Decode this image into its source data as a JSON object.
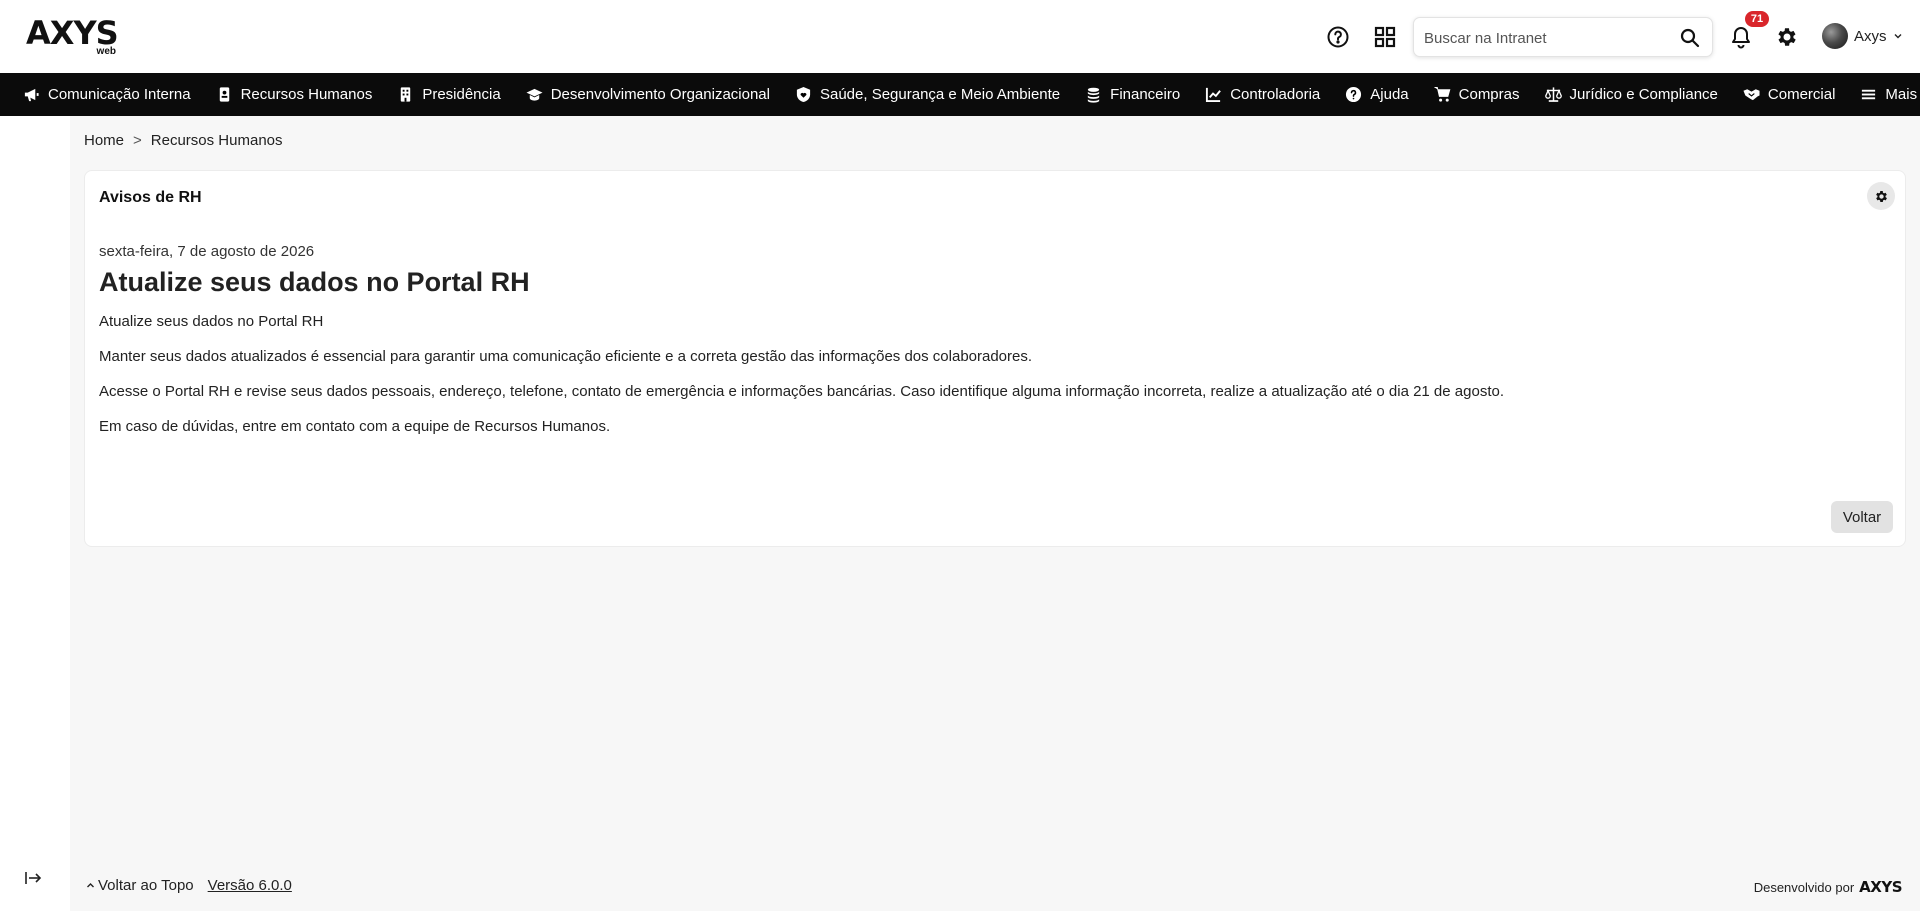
{
  "header": {
    "logo_main": "AXYS",
    "logo_sub": "web",
    "search_placeholder": "Buscar na Intranet",
    "notification_count": "71",
    "user_name": "Axys"
  },
  "nav": {
    "items": [
      {
        "label": "Comunicação Interna",
        "icon": "megaphone-icon"
      },
      {
        "label": "Recursos Humanos",
        "icon": "id-badge-icon"
      },
      {
        "label": "Presidência",
        "icon": "building-icon"
      },
      {
        "label": "Desenvolvimento Organizacional",
        "icon": "graduation-cap-icon"
      },
      {
        "label": "Saúde, Segurança e Meio Ambiente",
        "icon": "shield-heart-icon"
      },
      {
        "label": "Financeiro",
        "icon": "coins-icon"
      },
      {
        "label": "Controladoria",
        "icon": "line-chart-icon"
      },
      {
        "label": "Ajuda",
        "icon": "question-circle-icon"
      },
      {
        "label": "Compras",
        "icon": "cart-icon"
      },
      {
        "label": "Jurídico e Compliance",
        "icon": "scales-icon"
      },
      {
        "label": "Comercial",
        "icon": "handshake-icon"
      },
      {
        "label": "Mais",
        "icon": "menu-icon"
      }
    ]
  },
  "breadcrumb": {
    "home": "Home",
    "separator": ">",
    "current": "Recursos Humanos"
  },
  "card": {
    "title": "Avisos de RH",
    "date": "sexta-feira, 7 de agosto de 2026",
    "post_title": "Atualize seus dados no Portal RH",
    "paragraphs": [
      "Atualize seus dados no Portal RH",
      "Manter seus dados atualizados é essencial para garantir uma comunicação eficiente e a correta gestão das informações dos colaboradores.",
      "Acesse o Portal RH e revise seus dados pessoais, endereço, telefone, contato de emergência e informações bancárias. Caso identifique alguma informação incorreta, realize a atualização até o dia 21 de agosto.",
      "Em caso de dúvidas, entre em contato com a equipe de Recursos Humanos."
    ],
    "back_label": "Voltar"
  },
  "footer": {
    "to_top": "Voltar ao Topo",
    "version": "Versão 6.0.0",
    "developed_by": "Desenvolvido por",
    "dev_logo": "AXYS"
  },
  "colors": {
    "nav_bg": "#0b0b0b",
    "badge": "#d9262b",
    "page_bg": "#f7f7f7"
  }
}
